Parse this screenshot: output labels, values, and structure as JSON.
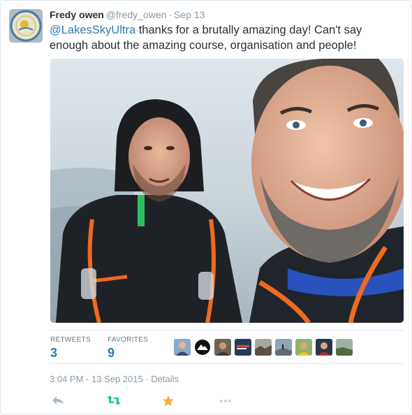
{
  "tweet": {
    "fullname": "Fredy owen",
    "username": "@fredy_owen",
    "separator": "·",
    "date": "Sep 13",
    "mention": "@LakesSkyUltra",
    "text": " thanks for a brutally amazing day! Can't say enough about the amazing course, organisation and people!",
    "avatar_icon": "circular-logo-avatar"
  },
  "stats": {
    "retweets_label": "RETWEETS",
    "retweets_count": "3",
    "favorites_label": "FAVORITES",
    "favorites_count": "9"
  },
  "favoriters": [
    {
      "icon": "user-avatar-1"
    },
    {
      "icon": "mountain-logo-avatar"
    },
    {
      "icon": "user-avatar-3"
    },
    {
      "icon": "banner-logo-avatar"
    },
    {
      "icon": "landscape-avatar-1"
    },
    {
      "icon": "landscape-avatar-2"
    },
    {
      "icon": "user-avatar-7"
    },
    {
      "icon": "user-avatar-8"
    },
    {
      "icon": "landscape-avatar-3"
    }
  ],
  "meta": {
    "time": "3:04 PM - 13 Sep 2015",
    "separator": "·",
    "details": "Details"
  },
  "actions": {
    "reply_icon": "reply-icon",
    "retweet_icon": "retweet-icon",
    "favorite_icon": "star-icon",
    "more_icon": "more-dots-icon"
  },
  "colors": {
    "link": "#2b7bb9",
    "muted": "#8899a6",
    "retweet": "#19cf86",
    "favorite": "#ffac33"
  }
}
